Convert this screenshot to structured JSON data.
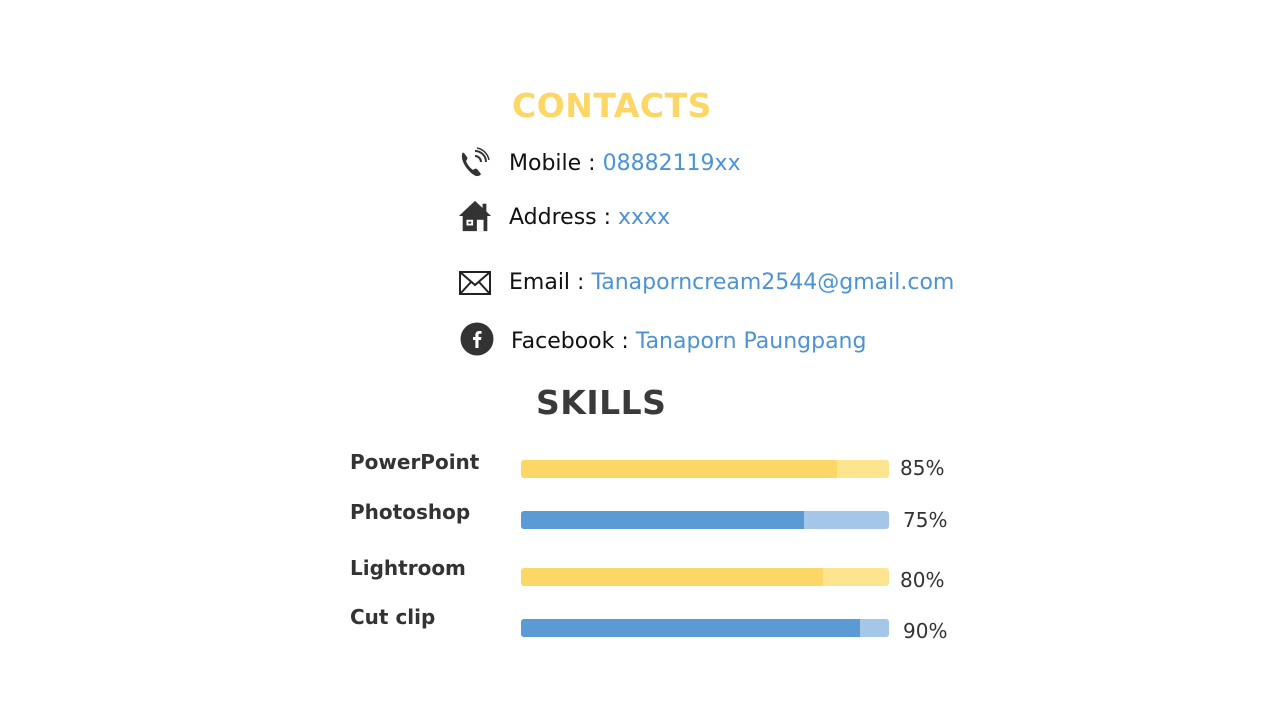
{
  "contacts": {
    "title": "CONTACTS",
    "items": [
      {
        "id": "mobile",
        "label": "Mobile",
        "sep": " : ",
        "value": "08882119xx",
        "icon": "phone-icon"
      },
      {
        "id": "address",
        "label": "Address",
        "sep": " : ",
        "value": "xxxx",
        "icon": "home-icon"
      },
      {
        "id": "email",
        "label": "Email",
        "sep": " : ",
        "value": "Tanaporncream2544@gmail.com",
        "icon": "envelope-icon"
      },
      {
        "id": "facebook",
        "label": "Facebook",
        "sep": " : ",
        "value": "Tanaporn Paungpang",
        "icon": "facebook-icon"
      }
    ]
  },
  "skills": {
    "title": "SKILLS",
    "items": [
      {
        "name": "PowerPoint",
        "percent_label": "85%",
        "level": 0.86,
        "color": "#fdd765",
        "track": "#fde58f"
      },
      {
        "name": "Photoshop",
        "percent_label": "75%",
        "level": 0.77,
        "color": "#5b9bd5",
        "track": "#a3c6e9"
      },
      {
        "name": "Lightroom",
        "percent_label": "80%",
        "level": 0.82,
        "color": "#fdd765",
        "track": "#fde58f"
      },
      {
        "name": "Cut clip",
        "percent_label": "90%",
        "level": 0.92,
        "color": "#5b9bd5",
        "track": "#a3c6e9"
      }
    ]
  },
  "colors": {
    "accent_yellow": "#fdd765",
    "accent_blue": "#5b9bd5",
    "link_blue": "#4d93d3",
    "heading_dark": "#3a3a3a"
  }
}
